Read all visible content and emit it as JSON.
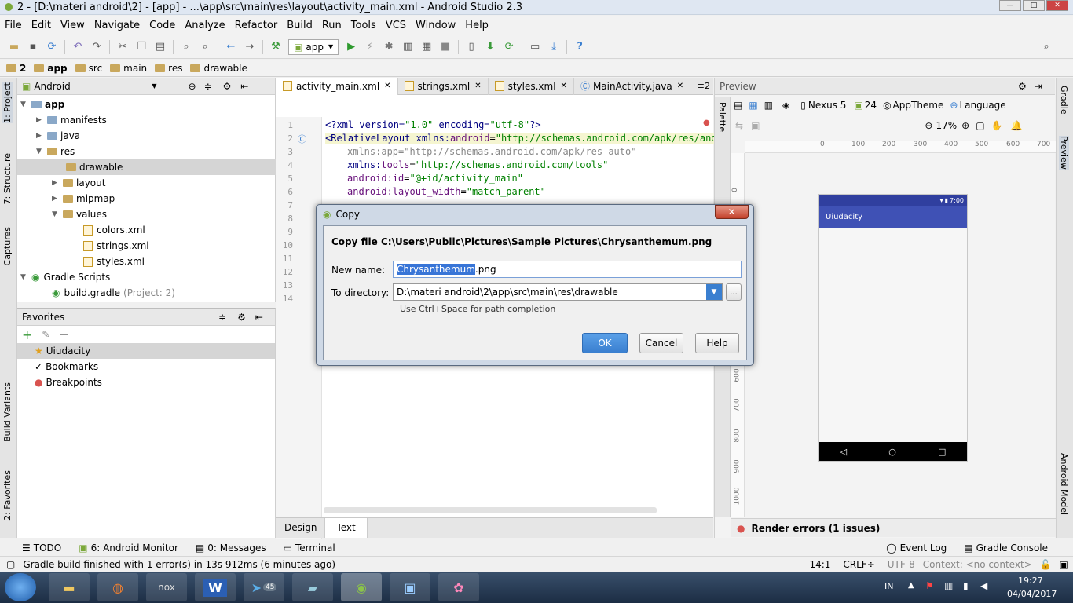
{
  "window": {
    "title": "2 - [D:\\materi android\\2] - [app] - ...\\app\\src\\main\\res\\layout\\activity_main.xml - Android Studio 2.3",
    "min": "—",
    "max": "□",
    "close": "✕"
  },
  "menu": [
    "File",
    "Edit",
    "View",
    "Navigate",
    "Code",
    "Analyze",
    "Refactor",
    "Build",
    "Run",
    "Tools",
    "VCS",
    "Window",
    "Help"
  ],
  "toolbar": {
    "run_config": "app"
  },
  "breadcrumb": [
    "2",
    "app",
    "src",
    "main",
    "res",
    "drawable"
  ],
  "left_tabs": [
    "1: Project",
    "7: Structure",
    "Captures",
    "Build Variants",
    "2: Favorites"
  ],
  "right_tabs": [
    "Gradle",
    "Preview",
    "Android Model"
  ],
  "project": {
    "view": "Android",
    "tree": [
      {
        "label": "app",
        "bold": true
      },
      {
        "label": "manifests"
      },
      {
        "label": "java"
      },
      {
        "label": "res"
      },
      {
        "label": "drawable"
      },
      {
        "label": "layout"
      },
      {
        "label": "mipmap"
      },
      {
        "label": "values"
      },
      {
        "label": "colors.xml"
      },
      {
        "label": "strings.xml"
      },
      {
        "label": "styles.xml"
      },
      {
        "label": "Gradle Scripts"
      },
      {
        "label": "build.gradle",
        "note": "(Project: 2)"
      }
    ]
  },
  "favorites": {
    "title": "Favorites",
    "items": [
      "Uiudacity",
      "Bookmarks",
      "Breakpoints"
    ]
  },
  "editor": {
    "tabs": [
      "activity_main.xml",
      "strings.xml",
      "styles.xml",
      "MainActivity.java"
    ],
    "tab_overflow": "≡2",
    "lines": [
      "1",
      "2",
      "3",
      "4",
      "5",
      "6",
      "7",
      "8",
      "9",
      "10",
      "11",
      "12",
      "13",
      "14"
    ],
    "code": {
      "l1a": "<?xml version=",
      "l1b": "\"1.0\"",
      "l1c": " encoding=",
      "l1d": "\"utf-8\"",
      "l1e": "?>",
      "l2a": "<RelativeLayout ",
      "l2b": "xmlns:",
      "l2c": "android",
      "l2d": "=",
      "l2e": "\"http://schemas.android.com/apk/res/andro",
      "l3a": "xmlns:app=",
      "l3b": "\"http://schemas.android.com/apk/res-auto\"",
      "l4a": "xmlns:",
      "l4b": "tools",
      "l4c": "=",
      "l4d": "\"http://schemas.android.com/tools\"",
      "l5a": "android:",
      "l5b": "id",
      "l5c": "=",
      "l5d": "\"@+id/activity_main\"",
      "l6a": "android:",
      "l6b": "layout_width",
      "l6c": "=",
      "l6d": "\"match_parent\""
    },
    "bottom_tabs": [
      "Design",
      "Text"
    ]
  },
  "preview": {
    "title": "Preview",
    "palette": "Palette",
    "device": "Nexus 5",
    "api": "24",
    "theme": "AppTheme",
    "language": "Language",
    "zoom": "17%",
    "ruler_x": [
      "0",
      "100",
      "200",
      "300",
      "400",
      "500",
      "600",
      "700"
    ],
    "ruler_y": [
      "0",
      "600",
      "700",
      "800",
      "900",
      "1000"
    ],
    "status_time": "7:00",
    "app_title": "Uiudacity",
    "render_errors": "Render errors (1 issues)"
  },
  "dialog": {
    "title": "Copy",
    "heading": "Copy file C:\\Users\\Public\\Pictures\\Sample Pictures\\Chrysanthemum.png",
    "new_name_label": "New name:",
    "new_name_sel": "Chrysanthemum",
    "new_name_rest": ".png",
    "dir_label": "To directory:",
    "dir_value": "D:\\materi android\\2\\app\\src\\main\\res\\drawable",
    "browse": "...",
    "hint": "Use Ctrl+Space for path completion",
    "ok": "OK",
    "cancel": "Cancel",
    "help": "Help"
  },
  "bottom_tools": {
    "todo": "TODO",
    "monitor": "6: Android Monitor",
    "messages": "0: Messages",
    "terminal": "Terminal",
    "eventlog": "Event Log",
    "gradle_console": "Gradle Console"
  },
  "status": {
    "message": "Gradle build finished with 1 error(s) in 13s 912ms (6 minutes ago)",
    "pos": "14:1",
    "crlf": "CRLF÷",
    "enc": "UTF-8",
    "context": "Context: <no context>"
  },
  "taskbar": {
    "lang": "IN",
    "time": "19:27",
    "date": "04/04/2017",
    "telegram_badge": "45",
    "nox": "nox"
  }
}
